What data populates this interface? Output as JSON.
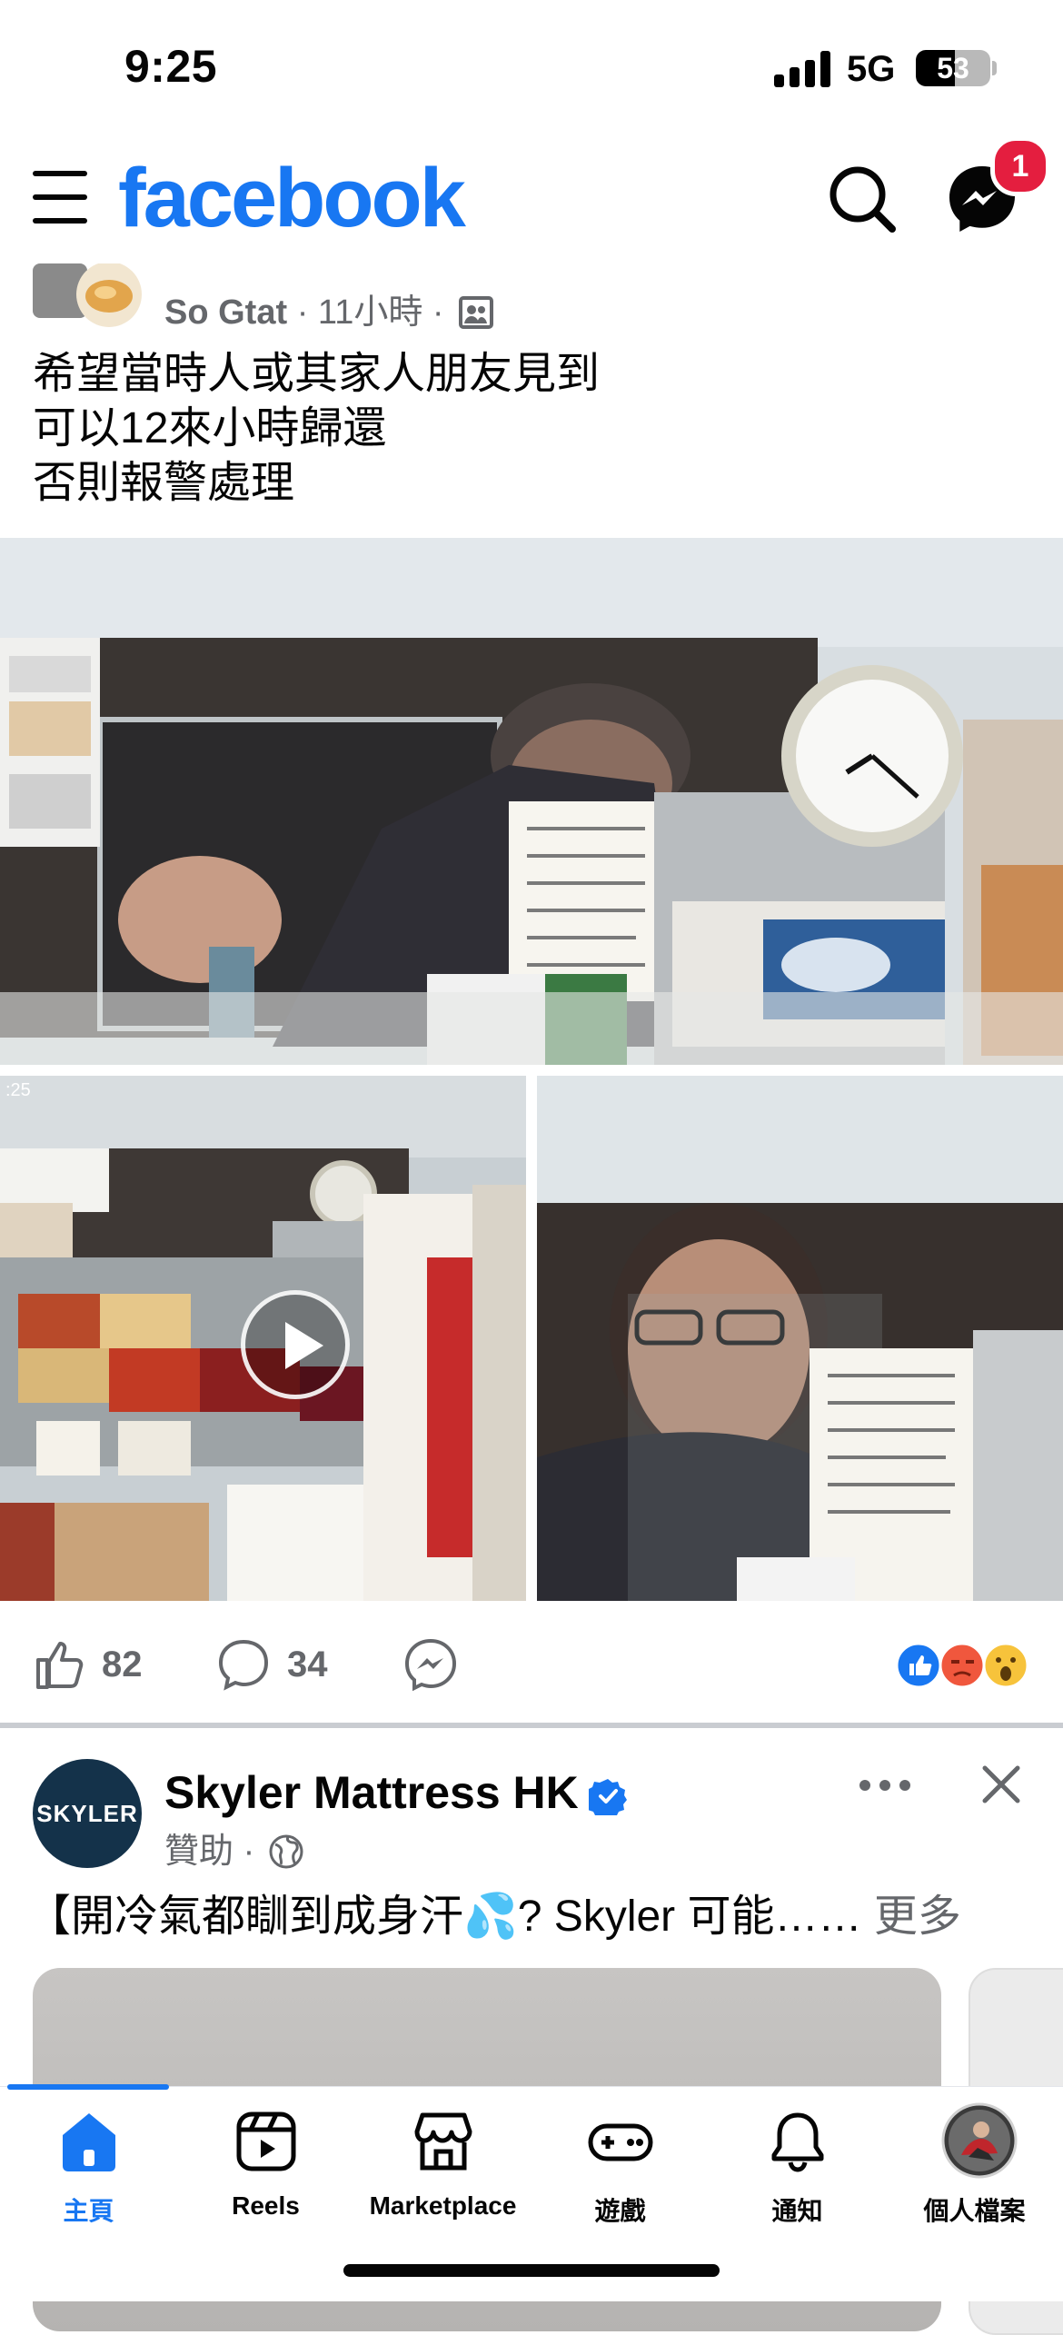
{
  "status_bar": {
    "time": "9:25",
    "network": "5G",
    "battery": "53",
    "battery_level": 0.53
  },
  "header": {
    "app_name": "facebook",
    "messenger_badge": "1"
  },
  "post": {
    "author": "So Gtat",
    "time_ago": "11小時",
    "separator": "·",
    "text_lines": [
      "希望當時人或其家人朋友見到",
      "可以12來小時歸還",
      "否則報警處理"
    ],
    "video_overlay_text": ":25",
    "likes": "82",
    "comments": "34"
  },
  "sponsored": {
    "name": "Skyler Mattress HK",
    "avatar_text": "SKYLER",
    "label": "贊助",
    "separator": "·",
    "text": "【開冷氣都瞓到成身汗💦? Skyler 可能……",
    "more": "更多"
  },
  "bottom_nav": {
    "items": [
      {
        "label": "主頁",
        "icon": "home-icon",
        "active": true
      },
      {
        "label": "Reels",
        "icon": "reels-icon",
        "active": false
      },
      {
        "label": "Marketplace",
        "icon": "marketplace-icon",
        "active": false
      },
      {
        "label": "遊戲",
        "icon": "gaming-icon",
        "active": false
      },
      {
        "label": "通知",
        "icon": "bell-icon",
        "active": false
      },
      {
        "label": "個人檔案",
        "icon": "profile-avatar",
        "active": false
      }
    ]
  },
  "colors": {
    "brand": "#1877f2",
    "badge": "#e41e3f",
    "secondary_text": "#65676b"
  }
}
